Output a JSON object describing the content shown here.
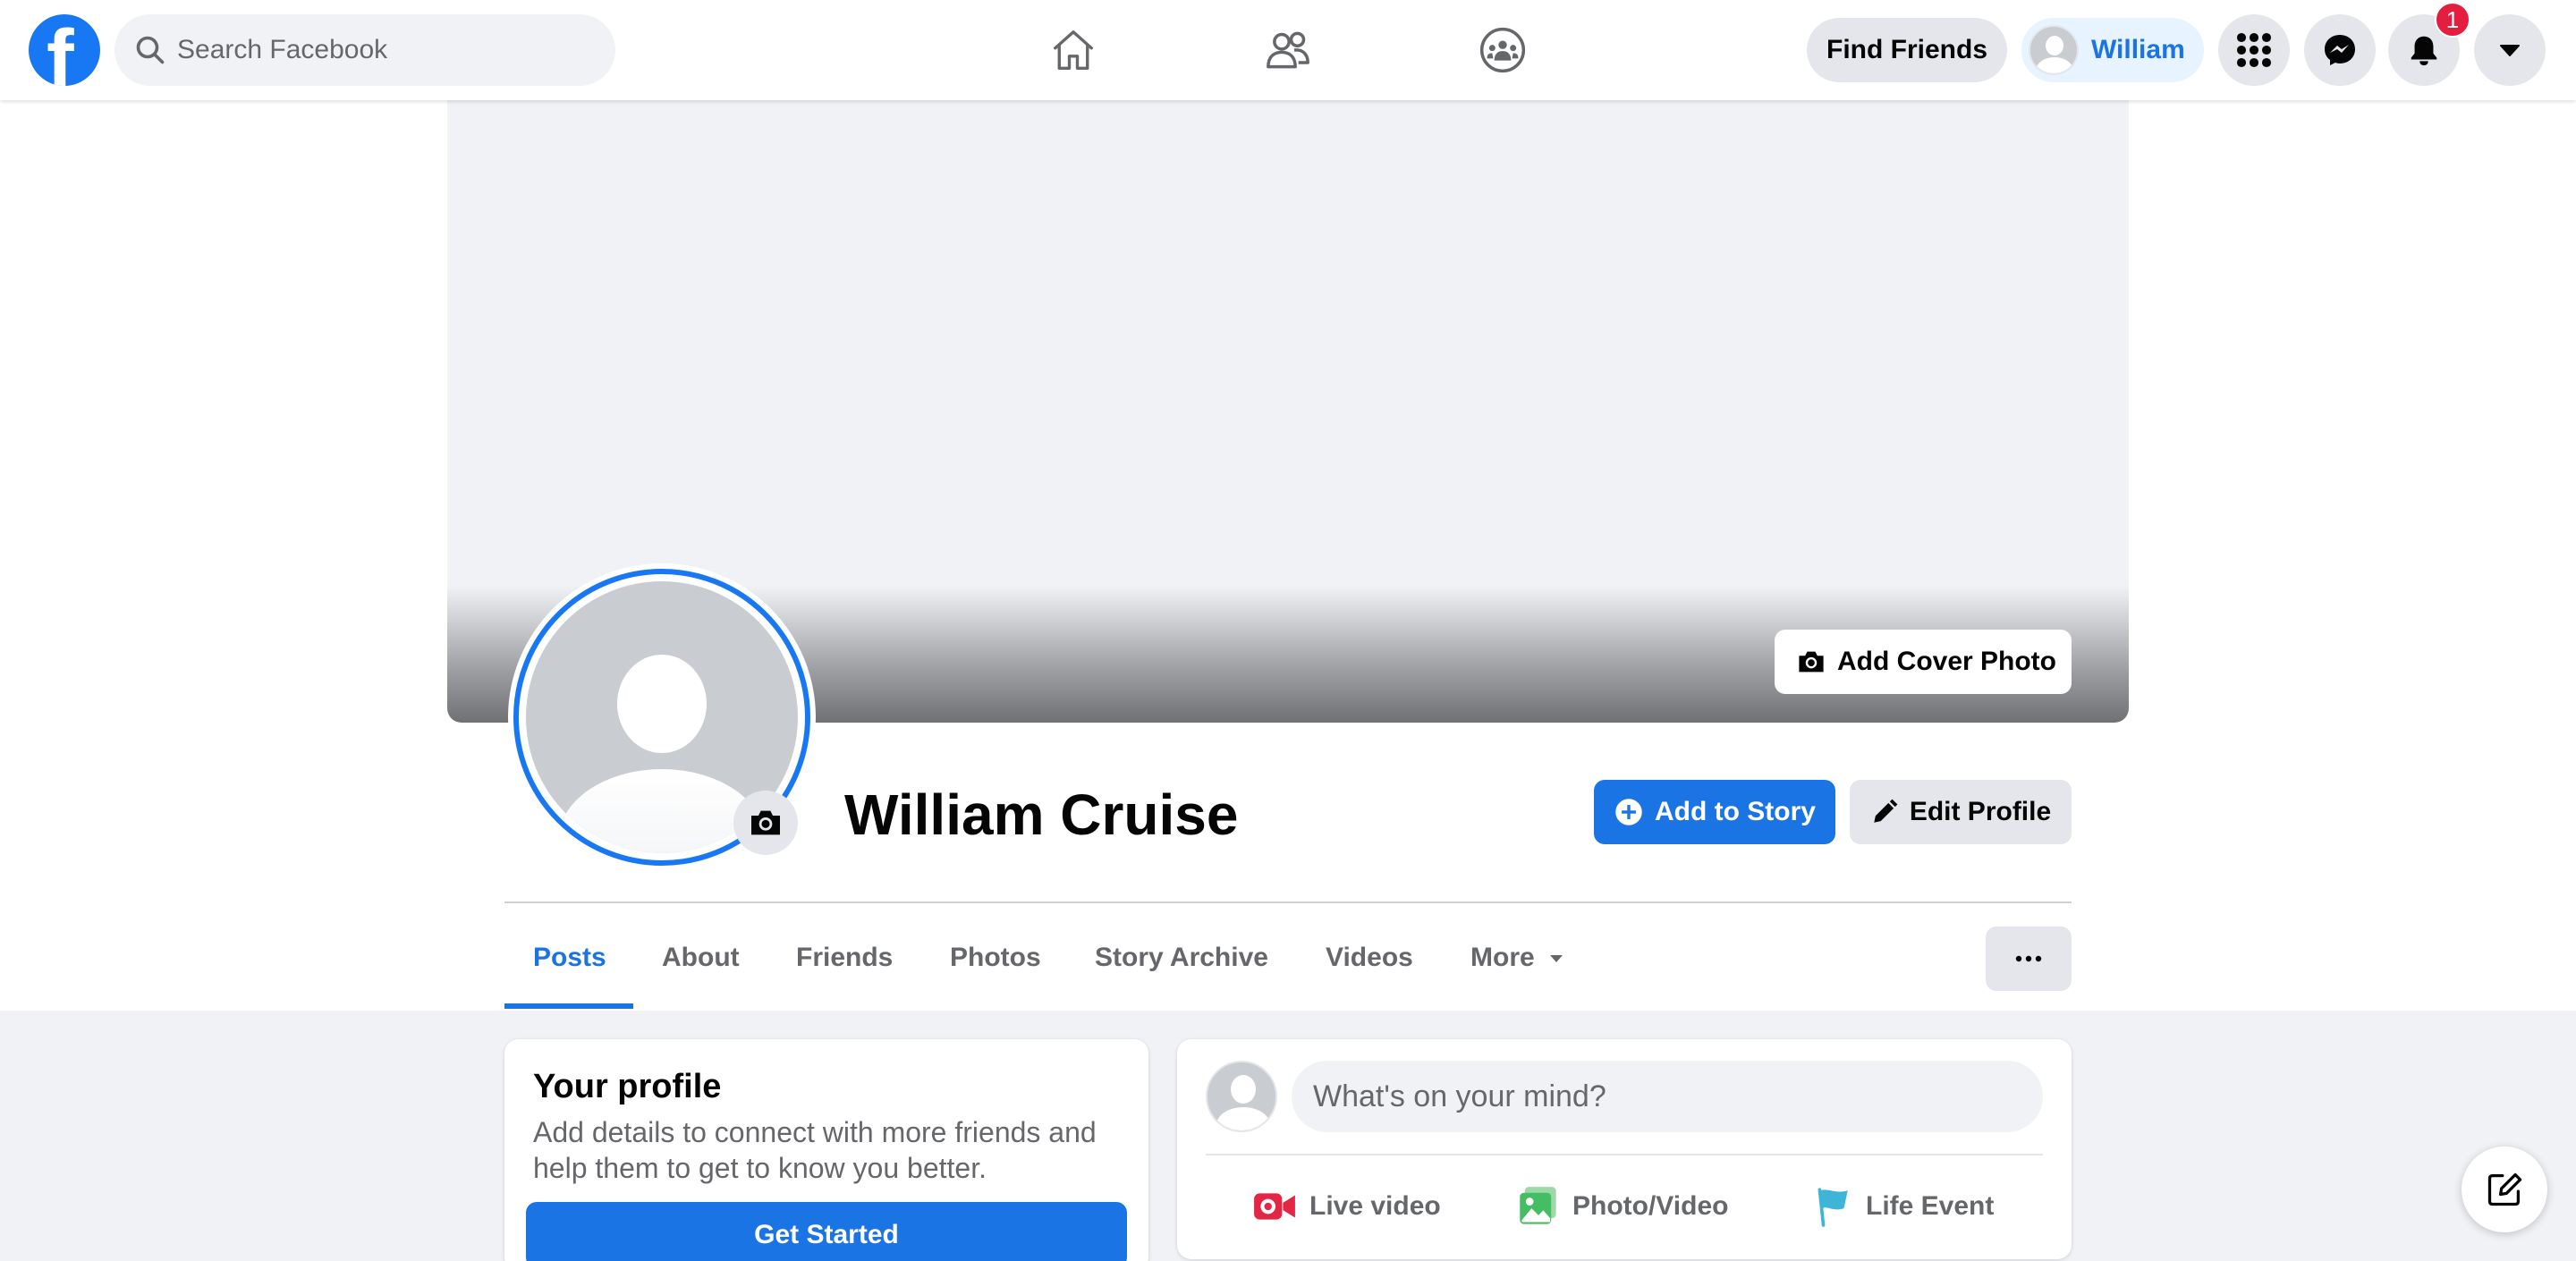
{
  "topbar": {
    "search_placeholder": "Search Facebook",
    "find_friends_label": "Find Friends",
    "user_name": "William",
    "notifications_count": "1"
  },
  "profile": {
    "name": "William Cruise",
    "add_cover_label": "Add Cover Photo",
    "add_story_label": "Add to Story",
    "edit_profile_label": "Edit Profile"
  },
  "tabs": [
    {
      "label": "Posts",
      "active": true
    },
    {
      "label": "About"
    },
    {
      "label": "Friends"
    },
    {
      "label": "Photos"
    },
    {
      "label": "Story Archive"
    },
    {
      "label": "Videos"
    },
    {
      "label": "More"
    }
  ],
  "intro_card": {
    "title": "Your profile",
    "text": "Add details to connect with more friends and help them to get to know you better.",
    "button_label": "Get Started"
  },
  "composer": {
    "placeholder": "What's on your mind?",
    "actions": [
      {
        "label": "Live video",
        "icon": "live-video-icon"
      },
      {
        "label": "Photo/Video",
        "icon": "photo-video-icon"
      },
      {
        "label": "Life Event",
        "icon": "flag-icon"
      }
    ]
  },
  "colors": {
    "accent": "#1b74e4",
    "badge": "#e41e3f",
    "live": "#e42645",
    "photo": "#45bd62",
    "life_event": "#3eb5d6"
  }
}
